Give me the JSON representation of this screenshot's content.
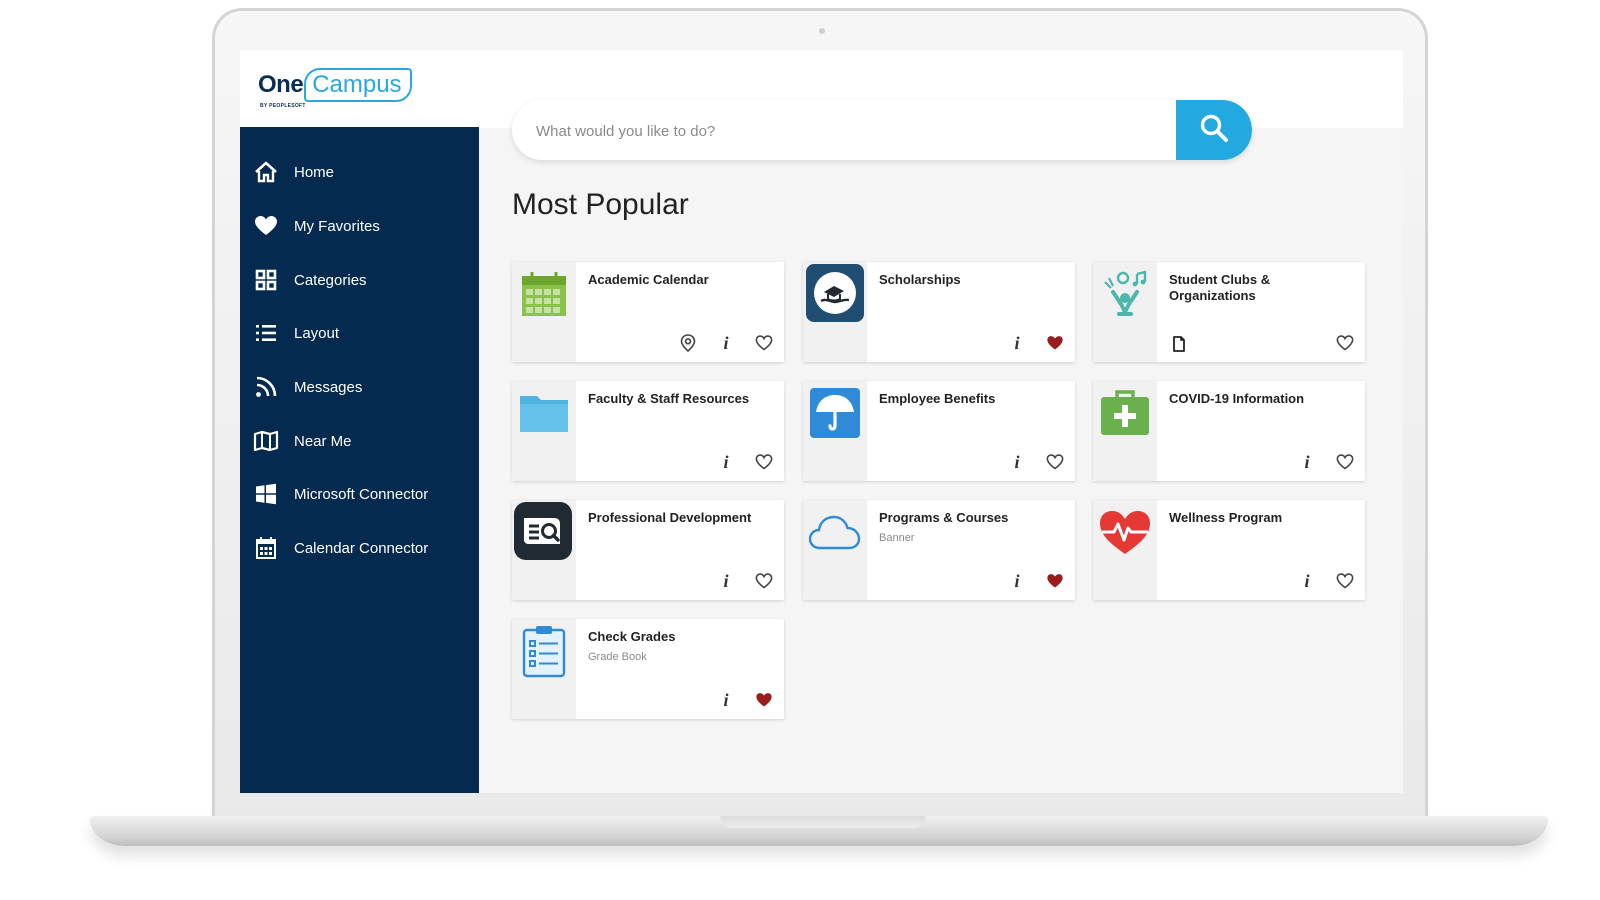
{
  "app": {
    "logo_one": "One",
    "logo_campus": "Campus",
    "logo_by": "BY PEOPLESOFT"
  },
  "sidebar": {
    "items": [
      {
        "label": "Home",
        "icon": "home-icon"
      },
      {
        "label": "My Favorites",
        "icon": "heart-icon"
      },
      {
        "label": "Categories",
        "icon": "grid-icon"
      },
      {
        "label": "Layout",
        "icon": "list-icon"
      },
      {
        "label": "Messages",
        "icon": "rss-icon"
      },
      {
        "label": "Near Me",
        "icon": "map-icon"
      },
      {
        "label": "Microsoft Connector",
        "icon": "windows-icon"
      },
      {
        "label": "Calendar Connector",
        "icon": "calendar-icon"
      }
    ]
  },
  "search": {
    "placeholder": "What would you like to do?",
    "button_icon": "search-icon"
  },
  "main": {
    "title": "Most Popular",
    "cards": [
      {
        "title": "Academic Calendar",
        "subtitle": "",
        "icon": "calendar-icon",
        "favorite": false,
        "location": true,
        "document": false
      },
      {
        "title": "Scholarships",
        "subtitle": "",
        "icon": "scholarship-icon",
        "favorite": true,
        "location": false,
        "document": false
      },
      {
        "title": "Student Clubs & Organizations",
        "subtitle": "",
        "icon": "clubs-icon",
        "favorite": false,
        "location": false,
        "document": true
      },
      {
        "title": "Faculty & Staff Resources",
        "subtitle": "",
        "icon": "folder-icon",
        "favorite": false,
        "location": false,
        "document": false
      },
      {
        "title": "Employee Benefits",
        "subtitle": "",
        "icon": "umbrella-icon",
        "favorite": false,
        "location": false,
        "document": false
      },
      {
        "title": "COVID-19 Information",
        "subtitle": "",
        "icon": "first-aid-icon",
        "favorite": false,
        "location": false,
        "document": false
      },
      {
        "title": "Professional Development",
        "subtitle": "",
        "icon": "book-search-icon",
        "favorite": false,
        "location": false,
        "document": false
      },
      {
        "title": "Programs & Courses",
        "subtitle": "Banner",
        "icon": "cloud-icon",
        "favorite": true,
        "location": false,
        "document": false
      },
      {
        "title": "Wellness Program",
        "subtitle": "",
        "icon": "heartbeat-icon",
        "favorite": false,
        "location": false,
        "document": false
      },
      {
        "title": "Check Grades",
        "subtitle": "Grade Book",
        "icon": "clipboard-icon",
        "favorite": true,
        "location": false,
        "document": false
      }
    ]
  },
  "colors": {
    "sidebar_bg": "#052a4f",
    "accent": "#22a9e0",
    "favorite": "#9b1c1c"
  }
}
